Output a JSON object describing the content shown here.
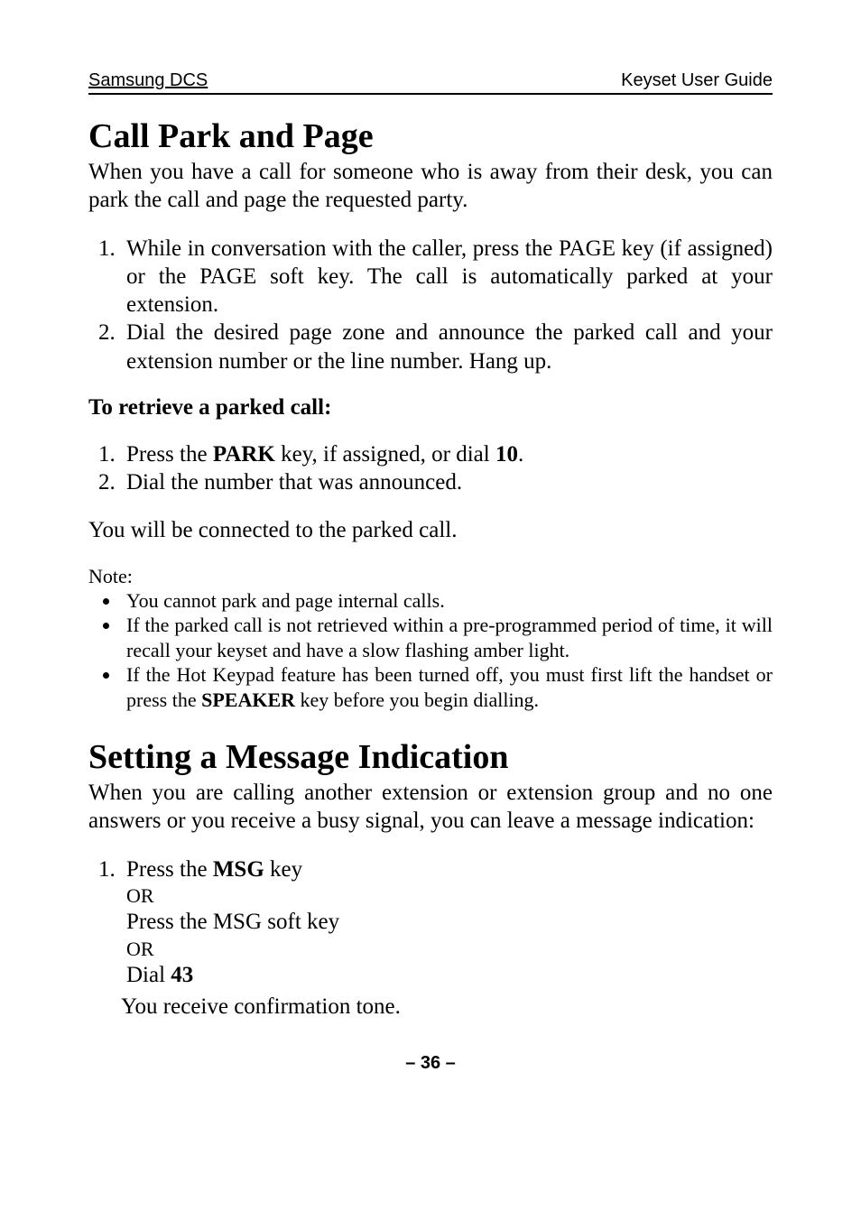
{
  "header": {
    "left": "Samsung DCS",
    "right": "Keyset User Guide"
  },
  "section1": {
    "title": "Call Park and Page",
    "intro": "When you have a call for someone who is away from their desk, you can park the call and page the requested party.",
    "steps": [
      {
        "pre": "While in conversation with the caller, press the ",
        "key1": "PAGE",
        "mid": " key (if assigned) or the ",
        "key2": "PAGE",
        "post": " soft key. The call is automatically parked at your extension."
      },
      {
        "text": "Dial the desired page zone and announce the parked call and your extension number or the line number. Hang up."
      }
    ],
    "retrieve_heading": "To retrieve a parked call:",
    "retrieve_steps": [
      {
        "pre": "Press the ",
        "bold1": "PARK",
        "mid": " key, if assigned, or dial ",
        "bold2": "10",
        "post": "."
      },
      {
        "text": "Dial the number that was announced."
      }
    ],
    "after_retrieve": "You will be connected to the parked call.",
    "note_label": "Note:",
    "notes": [
      {
        "text": "You cannot park and page internal calls."
      },
      {
        "text": "If the parked call is not retrieved within a pre-programmed period of time, it will recall your keyset and have a slow flashing amber light."
      },
      {
        "pre": "If the Hot Keypad feature has been turned off, you must first lift the handset or press the ",
        "bold": "SPEAKER",
        "post": " key before you begin dialling."
      }
    ]
  },
  "section2": {
    "title": "Setting a Message Indication",
    "intro": "When you are calling another extension or extension group and no one answers or you receive a busy signal, you can leave a message indication:",
    "step1": {
      "line1_pre": "Press the ",
      "line1_bold": "MSG",
      "line1_post": " key",
      "or1": "OR",
      "line2_pre": "Press the ",
      "line2_sc": "MSG",
      "line2_post": " soft key",
      "or2": "OR",
      "line3_pre": "Dial ",
      "line3_bold": "43",
      "confirm": "You receive confirmation tone."
    }
  },
  "footer": {
    "page_label": "– 36 –"
  }
}
